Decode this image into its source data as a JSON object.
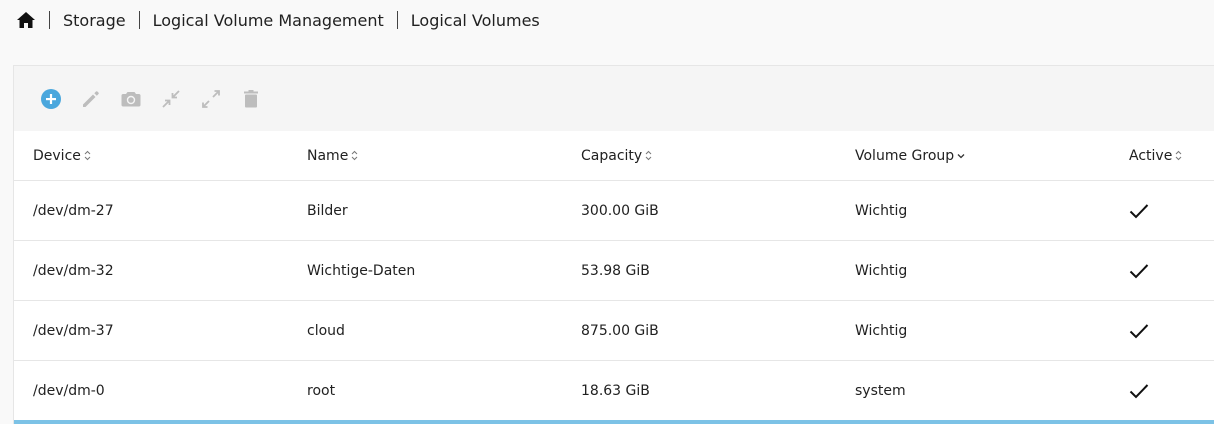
{
  "breadcrumb": {
    "home_icon": "home-icon",
    "items": [
      "Storage",
      "Logical Volume Management",
      "Logical Volumes"
    ]
  },
  "toolbar": {
    "buttons": [
      {
        "icon": "add-circle-icon",
        "color": "#4aa7dd"
      },
      {
        "icon": "pencil-icon",
        "color": "#bdbdbd"
      },
      {
        "icon": "camera-icon",
        "color": "#bdbdbd"
      },
      {
        "icon": "shrink-icon",
        "color": "#bdbdbd"
      },
      {
        "icon": "expand-icon",
        "color": "#bdbdbd"
      },
      {
        "icon": "trash-icon",
        "color": "#bdbdbd"
      }
    ]
  },
  "table": {
    "columns": [
      {
        "label": "Device",
        "sort": "unsorted"
      },
      {
        "label": "Name",
        "sort": "unsorted"
      },
      {
        "label": "Capacity",
        "sort": "unsorted"
      },
      {
        "label": "Volume Group",
        "sort": "descending"
      },
      {
        "label": "Active",
        "sort": "unsorted"
      }
    ],
    "rows": [
      {
        "device": "/dev/dm-27",
        "name": "Bilder",
        "capacity": "300.00 GiB",
        "volume_group": "Wichtig",
        "active": true
      },
      {
        "device": "/dev/dm-32",
        "name": "Wichtige-Daten",
        "capacity": "53.98 GiB",
        "volume_group": "Wichtig",
        "active": true
      },
      {
        "device": "/dev/dm-37",
        "name": "cloud",
        "capacity": "875.00 GiB",
        "volume_group": "Wichtig",
        "active": true
      },
      {
        "device": "/dev/dm-0",
        "name": "root",
        "capacity": "18.63 GiB",
        "volume_group": "system",
        "active": true
      }
    ],
    "accent_color": "#7cc2e6"
  }
}
